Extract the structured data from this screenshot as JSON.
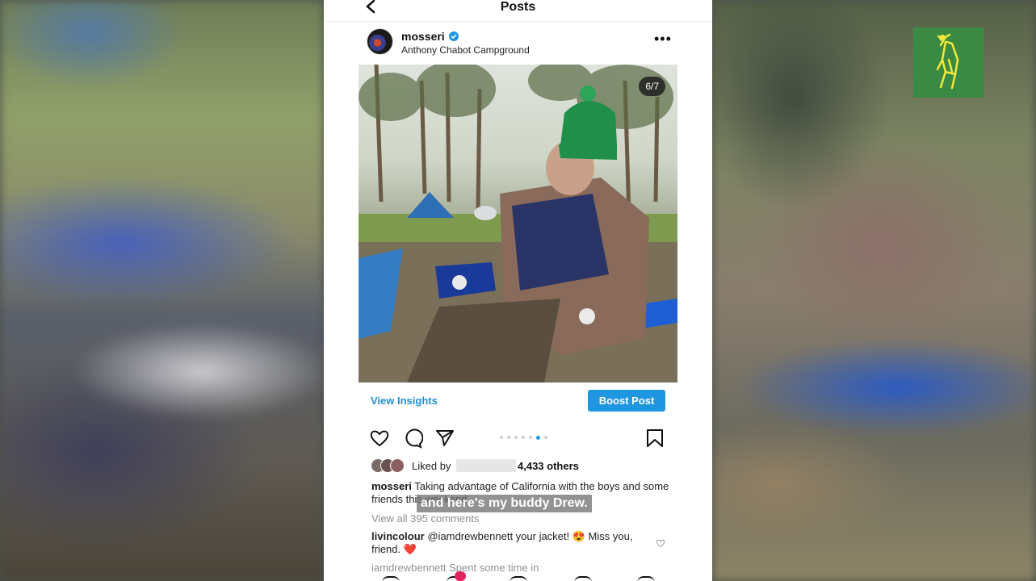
{
  "header": {
    "title": "Posts"
  },
  "post": {
    "username": "mosseri",
    "location": "Anthony Chabot Campground",
    "counter": "6/7",
    "view_insights": "View Insights",
    "boost_post": "Boost Post",
    "liked_by": "Liked by",
    "likes_others": "4,433 others",
    "caption_user": "mosseri",
    "caption_text": "Taking advantage of California with the boys and some friends this weekend",
    "view_comments": "View all 395 comments",
    "comment_user": "livincolour",
    "comment_text": "@iamdrewbennett your jacket! 😍 Miss you, friend. ❤️",
    "comment2_text": "iamdrewbennett Spent some time in"
  },
  "subtitle": "and here's my buddy Drew.",
  "colors": {
    "accent": "#1e96e0",
    "logo_bg": "#3b8a44",
    "logo_fg": "#f2e83a"
  },
  "icons": [
    "back-icon",
    "verified-icon",
    "more-icon",
    "heart-icon",
    "comment-icon",
    "share-icon",
    "bookmark-icon"
  ]
}
